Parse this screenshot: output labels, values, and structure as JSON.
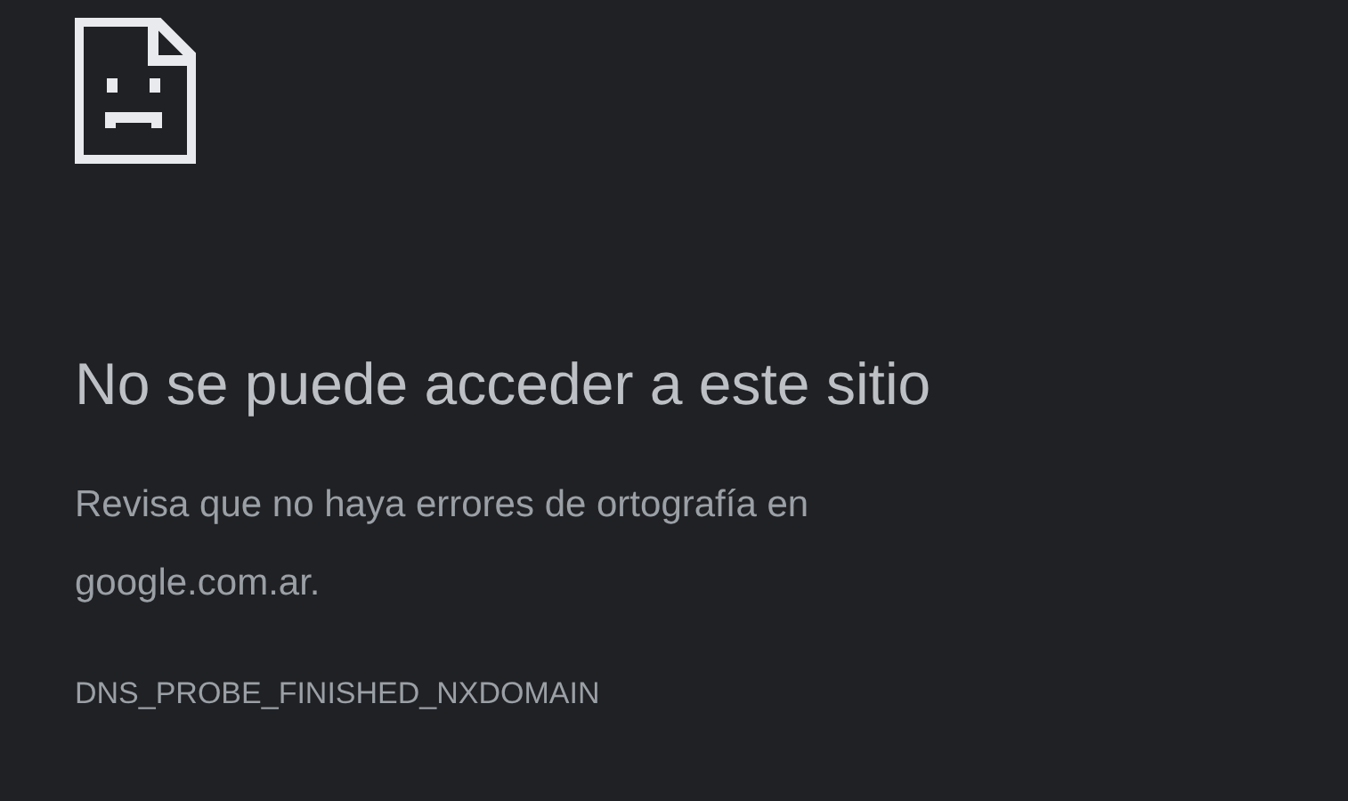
{
  "error_page": {
    "title": "No se puede acceder a este sitio",
    "message": "Revisa que no haya errores de ortografía en google.com.ar.",
    "error_code": "DNS_PROBE_FINISHED_NXDOMAIN"
  }
}
